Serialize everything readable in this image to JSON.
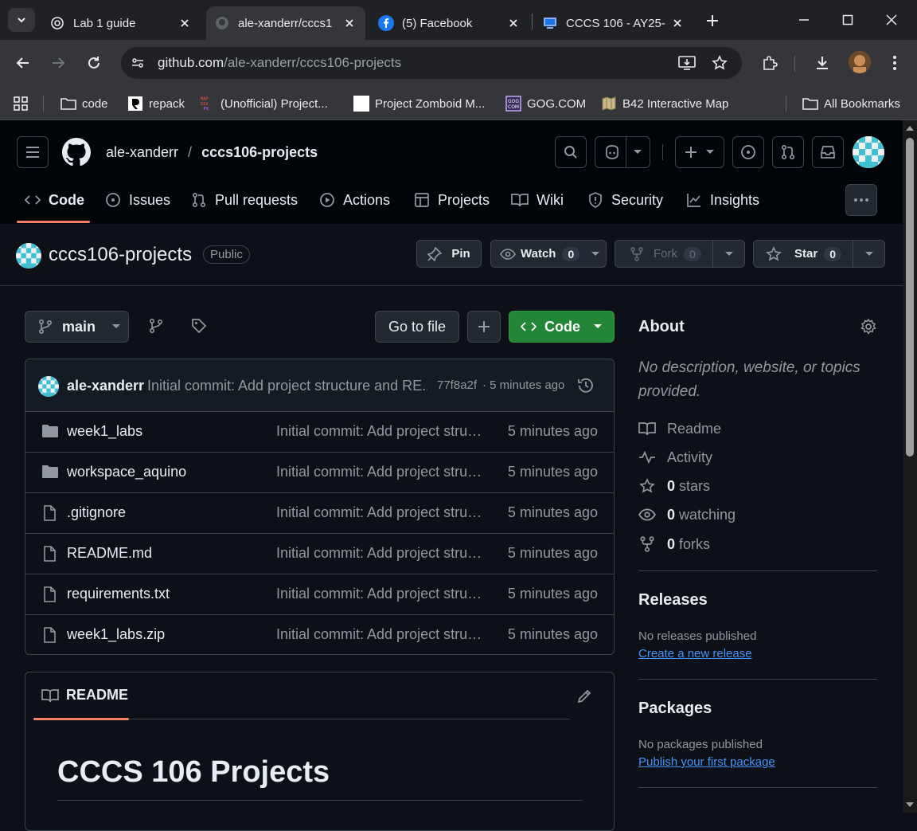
{
  "browser": {
    "tabs": [
      {
        "title": "Lab 1 guide",
        "icon": "chatgpt-icon"
      },
      {
        "title": "ale-xanderr/cccs1",
        "icon": "github-icon"
      },
      {
        "title": "(5) Facebook",
        "icon": "facebook-icon"
      },
      {
        "title": "CCCS 106 - AY25-",
        "icon": "lms-icon"
      }
    ],
    "url_host": "github.com",
    "url_path": "/ale-xanderr/cccs106-projects",
    "bookmarks": [
      {
        "label": "code",
        "icon": "folder-icon"
      },
      {
        "label": "repack",
        "icon": "repack-icon"
      },
      {
        "label": "(Unofficial) Project...",
        "icon": "mapsix-icon"
      },
      {
        "label": "Project Zomboid M...",
        "icon": "page-icon"
      },
      {
        "label": "GOG.COM",
        "icon": "gog-icon"
      },
      {
        "label": "B42 Interactive Map",
        "icon": "map-icon"
      }
    ],
    "all_bookmarks": "All Bookmarks"
  },
  "repo": {
    "owner": "ale-xanderr",
    "name": "cccs106-projects",
    "visibility": "Public",
    "nav": {
      "code": "Code",
      "issues": "Issues",
      "pulls": "Pull requests",
      "actions": "Actions",
      "projects": "Projects",
      "wiki": "Wiki",
      "security": "Security",
      "insights": "Insights"
    },
    "pin": "Pin",
    "watch": "Watch",
    "watch_count": "0",
    "fork": "Fork",
    "fork_count": "0",
    "star": "Star",
    "star_count": "0"
  },
  "files": {
    "branch": "main",
    "goto_file": "Go to file",
    "code_btn": "Code",
    "commit": {
      "author": "ale-xanderr",
      "message": "Initial commit: Add project structure and RE...",
      "sha": "77f8a2f",
      "time": "· 5 minutes ago"
    },
    "rows": [
      {
        "name": "week1_labs",
        "type": "folder",
        "msg": "Initial commit: Add project structure and README",
        "time": "5 minutes ago"
      },
      {
        "name": "workspace_aquino",
        "type": "folder",
        "msg": "Initial commit: Add project structure and README",
        "time": "5 minutes ago"
      },
      {
        "name": ".gitignore",
        "type": "file",
        "msg": "Initial commit: Add project structure and README",
        "time": "5 minutes ago"
      },
      {
        "name": "README.md",
        "type": "file",
        "msg": "Initial commit: Add project structure and README",
        "time": "5 minutes ago"
      },
      {
        "name": "requirements.txt",
        "type": "file",
        "msg": "Initial commit: Add project structure and README",
        "time": "5 minutes ago"
      },
      {
        "name": "week1_labs.zip",
        "type": "file",
        "msg": "Initial commit: Add project structure and README",
        "time": "5 minutes ago"
      }
    ]
  },
  "readme": {
    "tab_label": "README",
    "heading": "CCCS 106 Projects"
  },
  "about": {
    "title": "About",
    "description": "No description, website, or topics provided.",
    "readme": "Readme",
    "activity": "Activity",
    "stars_count": "0",
    "stars_label": "stars",
    "watching_count": "0",
    "watching_label": "watching",
    "forks_count": "0",
    "forks_label": "forks"
  },
  "releases": {
    "title": "Releases",
    "none": "No releases published",
    "link": "Create a new release"
  },
  "packages": {
    "title": "Packages",
    "none": "No packages published",
    "link": "Publish your first package"
  },
  "colors": {
    "accent_green": "#238636",
    "link_blue": "#4493f8",
    "underline_orange": "#f78166"
  }
}
